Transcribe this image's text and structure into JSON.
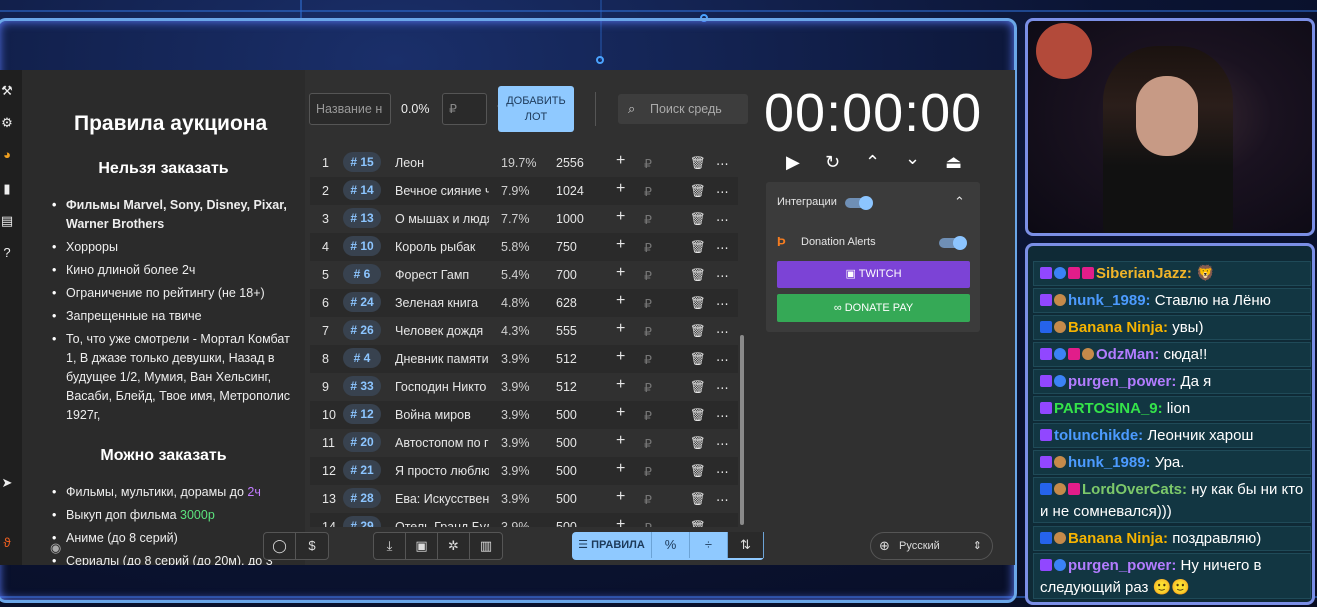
{
  "app": {
    "rules_title": "Правила аукциона",
    "forbidden_heading": "Нельзя заказать",
    "forbidden_items": [
      "Фильмы Marvel, Sony, Disney, Pixar, Warner Brothers",
      "Хорроры",
      "Кино длиной более 2ч",
      "Ограничение по рейтингу (не 18+)",
      "Запрещенные на твиче",
      "То, что уже смотрели - Мортал Комбат 1, В джазе только девушки, Назад в будущее 1/2, Мумия, Ван Хельсинг, Васаби, Блейд, Твое имя, Метрополис 1927г,"
    ],
    "allowed_heading": "Можно заказать",
    "allowed_items": [
      {
        "text": "Фильмы, мультики, дорамы до ",
        "highlight": "2ч",
        "hl_color": "#c27cff"
      },
      {
        "text": "Выкуп доп фильма ",
        "highlight": "3000р",
        "hl_color": "#5be37d"
      },
      {
        "text": "Аниме (до 8 серий)",
        "highlight": "",
        "hl_color": ""
      },
      {
        "text": "Сериалы (до 8 серий (до 20м), до 3",
        "highlight": "",
        "hl_color": ""
      }
    ],
    "controls": {
      "name_placeholder": "Название н",
      "percent": "0.0%",
      "currency_placeholder": "₽",
      "plus": "+",
      "add_button": "ДОБАВИТЬ ЛОТ",
      "search_placeholder": "Поиск средь"
    },
    "lots": [
      {
        "idx": "1",
        "tag": "# 15",
        "name": "Леон",
        "pct": "19.7%",
        "sum": "2556"
      },
      {
        "idx": "2",
        "tag": "# 14",
        "name": "Вечное сияние ч",
        "pct": "7.9%",
        "sum": "1024"
      },
      {
        "idx": "3",
        "tag": "# 13",
        "name": "О мышах и людя",
        "pct": "7.7%",
        "sum": "1000"
      },
      {
        "idx": "4",
        "tag": "# 10",
        "name": "Король рыбак",
        "pct": "5.8%",
        "sum": "750"
      },
      {
        "idx": "5",
        "tag": "# 6",
        "name": "Форест Гамп",
        "pct": "5.4%",
        "sum": "700"
      },
      {
        "idx": "6",
        "tag": "# 24",
        "name": "Зеленая книга",
        "pct": "4.8%",
        "sum": "628"
      },
      {
        "idx": "7",
        "tag": "# 26",
        "name": "Человек дождя",
        "pct": "4.3%",
        "sum": "555"
      },
      {
        "idx": "8",
        "tag": "# 4",
        "name": "Дневник памяти",
        "pct": "3.9%",
        "sum": "512"
      },
      {
        "idx": "9",
        "tag": "# 33",
        "name": "Господин Никто",
        "pct": "3.9%",
        "sum": "512"
      },
      {
        "idx": "10",
        "tag": "# 12",
        "name": "Война миров",
        "pct": "3.9%",
        "sum": "500"
      },
      {
        "idx": "11",
        "tag": "# 20",
        "name": "Автостопом по г",
        "pct": "3.9%",
        "sum": "500"
      },
      {
        "idx": "12",
        "tag": "# 21",
        "name": "Я просто люблю",
        "pct": "3.9%",
        "sum": "500"
      },
      {
        "idx": "13",
        "tag": "# 28",
        "name": "Ева: Искусствен",
        "pct": "3.9%",
        "sum": "500"
      },
      {
        "idx": "14",
        "tag": "# 29",
        "name": "Отель Гранд Буд",
        "pct": "3.9%",
        "sum": "500"
      }
    ],
    "row_plus": "+",
    "row_rub": "₽",
    "timer": "00:00:00",
    "integrations": {
      "label": "Интеграции",
      "donation_alerts": "Donation Alerts",
      "twitch": "TWITCH",
      "donate_pay": "DONATE PAY"
    },
    "toolbar": {
      "rules_label": "ПРАВИЛА",
      "language": "Русский"
    },
    "icons": {
      "github": "github-icon",
      "dollar": "dollar-icon",
      "download": "download-icon",
      "save": "save-icon",
      "bug": "bug-icon",
      "trash": "trash-icon",
      "percent": "percent-icon",
      "divide": "divide-icon",
      "sort": "sort-icon",
      "globe": "globe-icon",
      "eye": "eye-icon"
    },
    "colors": {
      "accent": "#8fc9ff",
      "twitch": "#7c43d6",
      "donate_pay": "#35a956"
    }
  },
  "chat": [
    {
      "badges": [
        "tw",
        "num",
        "heart",
        "heart"
      ],
      "user": "SiberianJazz:",
      "color": "#f0b429",
      "text": " 🦁"
    },
    {
      "badges": [
        "tw",
        "mute"
      ],
      "user": "hunk_1989:",
      "color": "#4c9bff",
      "text": " Ставлю на Лёню"
    },
    {
      "badges": [
        "mod",
        "ico"
      ],
      "user": "Banana Ninja:",
      "color": "#f5b301",
      "text": " увы)"
    },
    {
      "badges": [
        "tw",
        "num",
        "heart",
        "ico"
      ],
      "user": "OdzMan:",
      "color": "#b27cff",
      "text": " сюда!!"
    },
    {
      "badges": [
        "tw",
        "num"
      ],
      "user": "purgen_power:",
      "color": "#b27cff",
      "text": " Да я"
    },
    {
      "badges": [
        "tw"
      ],
      "user": "PARTOSINA_9:",
      "color": "#34e34a",
      "text": " lion"
    },
    {
      "badges": [
        "tw"
      ],
      "user": "tolunchikde:",
      "color": "#4c9bff",
      "text": " Леончик харош"
    },
    {
      "badges": [
        "tw",
        "mute"
      ],
      "user": "hunk_1989:",
      "color": "#4c9bff",
      "text": " Ура."
    },
    {
      "badges": [
        "mod",
        "ico",
        "heart"
      ],
      "user": "LordOverCats:",
      "color": "#7cc86a",
      "text": " ну как бы ни кто и не сомневался)))"
    },
    {
      "badges": [
        "mod",
        "ico"
      ],
      "user": "Banana Ninja:",
      "color": "#f5b301",
      "text": " поздравляю)"
    },
    {
      "badges": [
        "tw",
        "num"
      ],
      "user": "purgen_power:",
      "color": "#b27cff",
      "text": " Ну ничего в следующий раз 🙂🙂"
    }
  ]
}
